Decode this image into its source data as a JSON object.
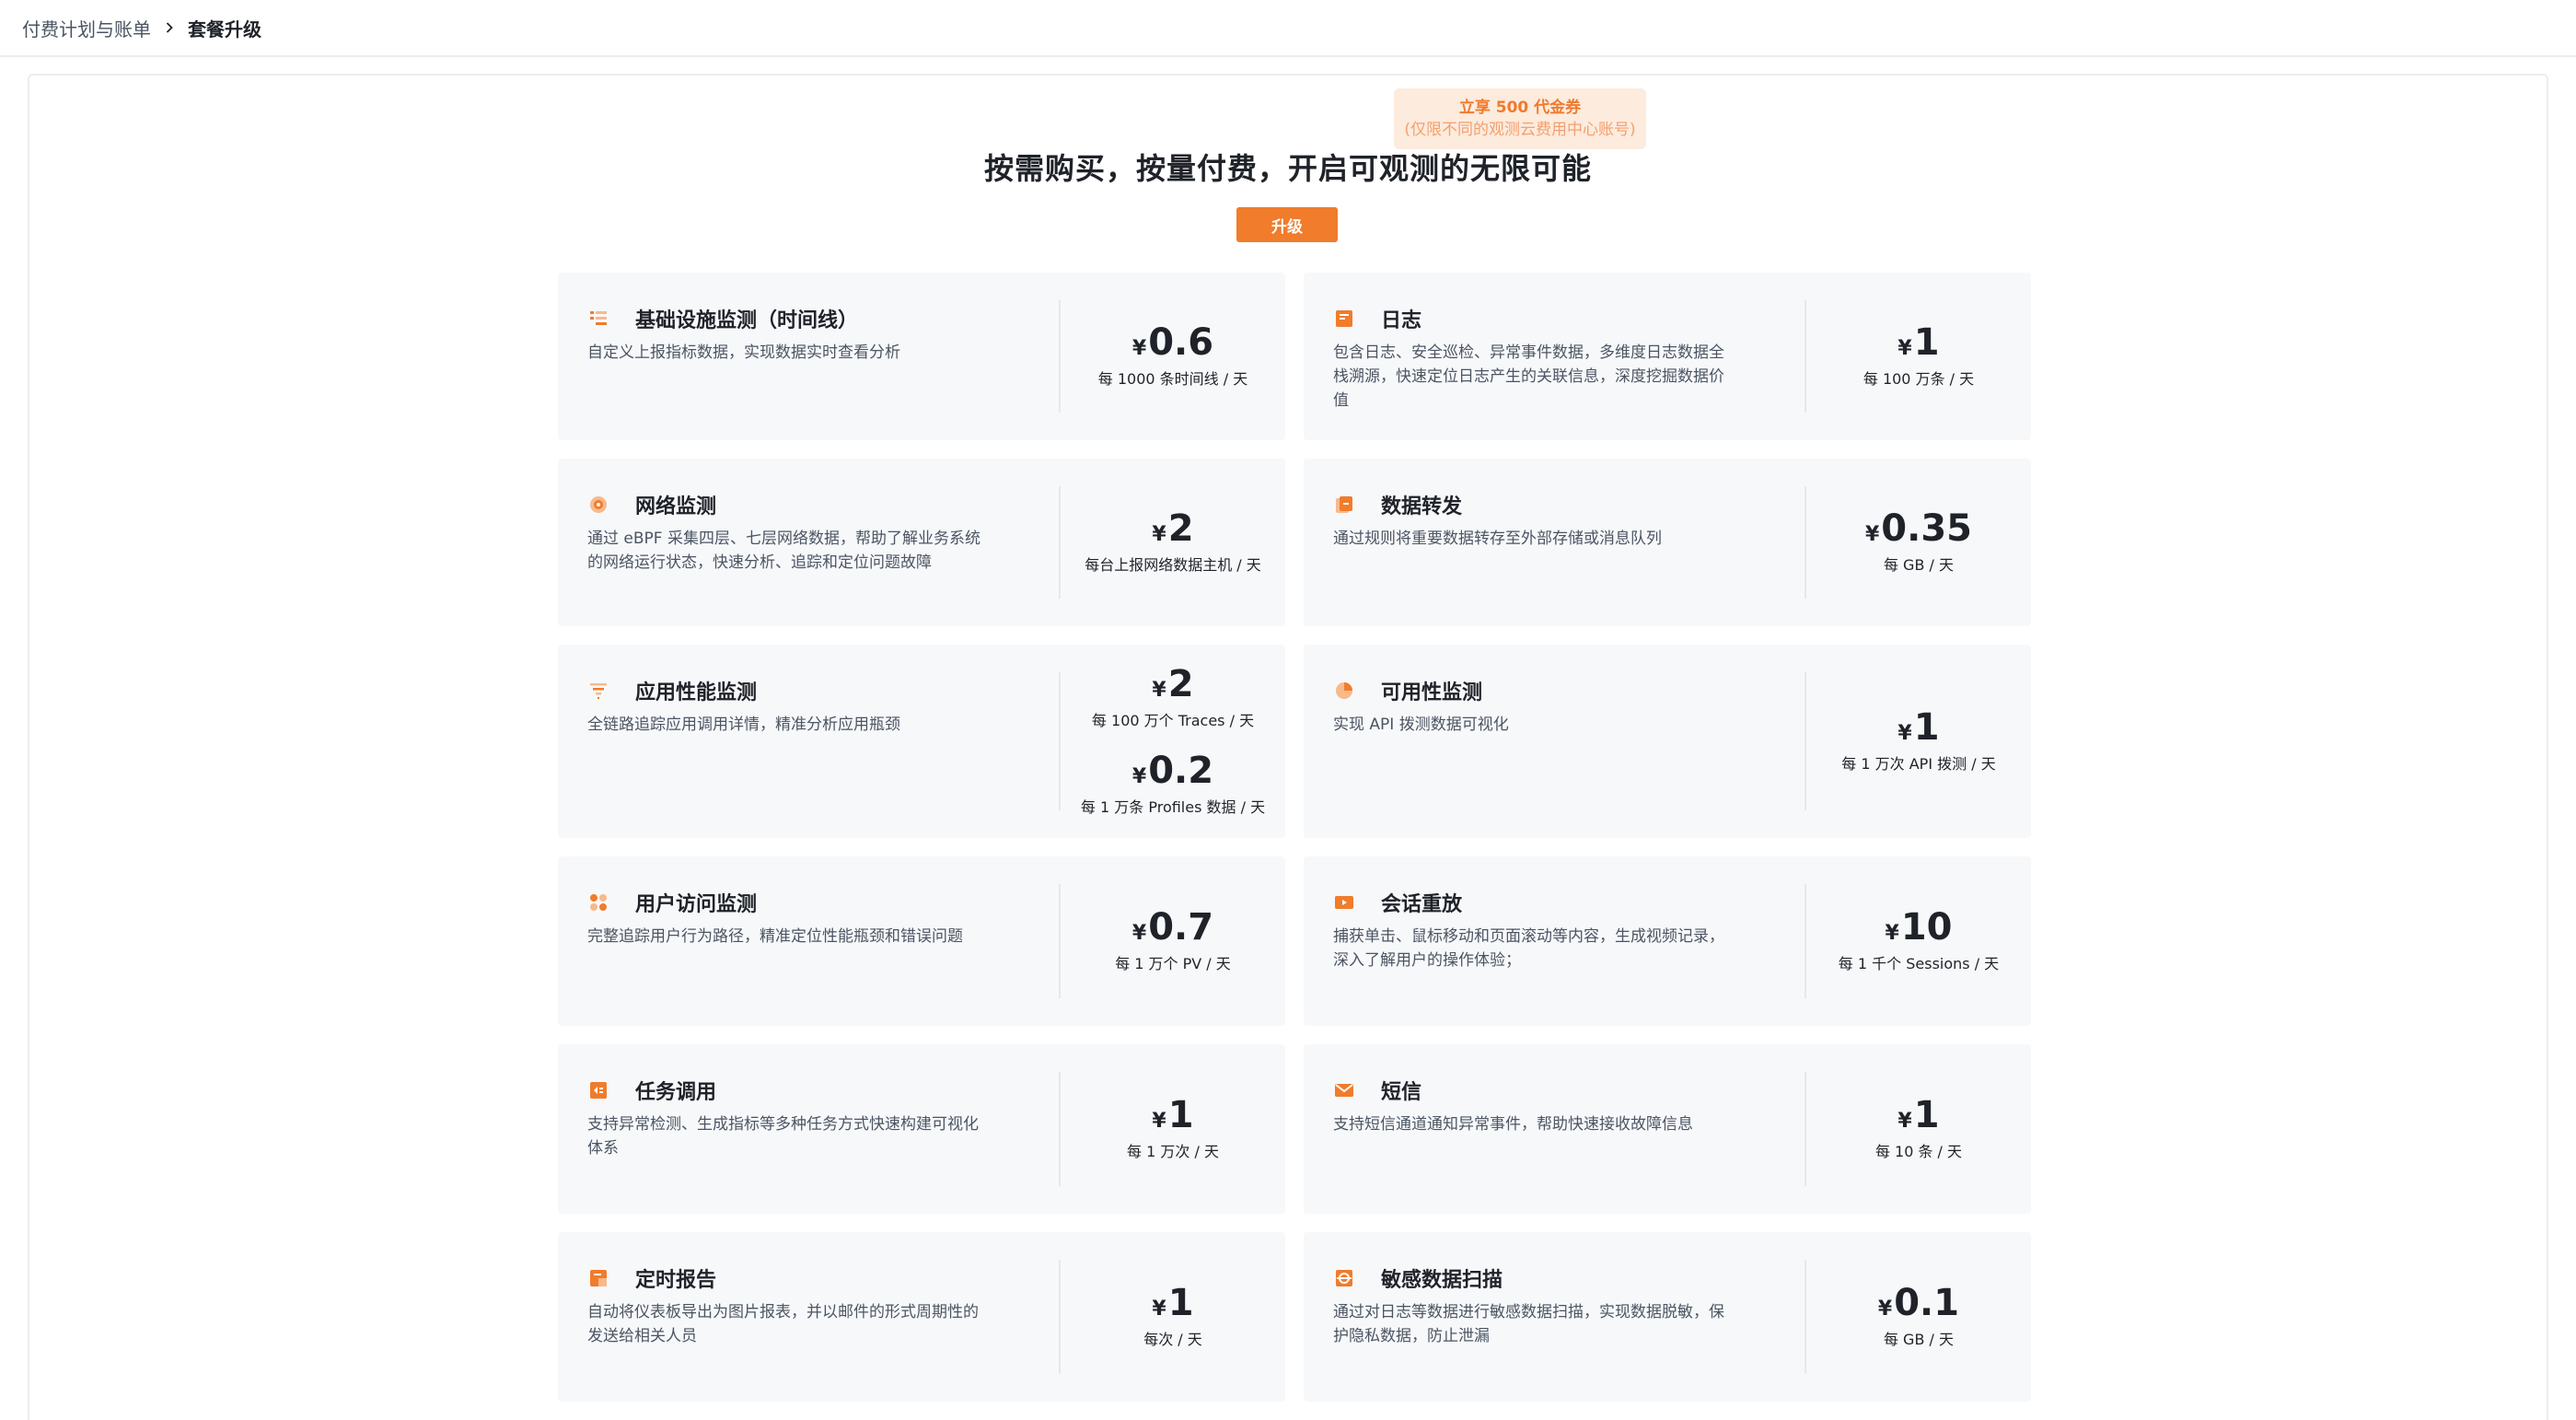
{
  "breadcrumb": {
    "parent": "付费计划与账单",
    "current": "套餐升级"
  },
  "promo": {
    "main": "立享 500 代金券",
    "sub": "(仅限不同的观测云费用中心账号)"
  },
  "headline": "按需购买，按量付费，开启可观测的无限可能",
  "upgrade_button": "升级",
  "accent_color": "#f07c2c",
  "currency": "¥",
  "cards": [
    {
      "title": "基础设施监测（时间线）",
      "icon": "infrastructure-icon",
      "desc": "自定义上报指标数据，实现数据实时查看分析",
      "prices": [
        {
          "value": "0.6",
          "unit": "每 1000 条时间线 / 天"
        }
      ]
    },
    {
      "title": "日志",
      "icon": "log-icon",
      "desc": "包含日志、安全巡检、异常事件数据，多维度日志数据全栈溯源，快速定位日志产生的关联信息，深度挖掘数据价值",
      "prices": [
        {
          "value": "1",
          "unit": "每 100 万条 / 天"
        }
      ]
    },
    {
      "title": "网络监测",
      "icon": "network-icon",
      "desc": "通过 eBPF 采集四层、七层网络数据，帮助了解业务系统的网络运行状态，快速分析、追踪和定位问题故障",
      "prices": [
        {
          "value": "2",
          "unit": "每台上报网络数据主机 / 天"
        }
      ]
    },
    {
      "title": "数据转发",
      "icon": "data-forward-icon",
      "desc": "通过规则将重要数据转存至外部存储或消息队列",
      "prices": [
        {
          "value": "0.35",
          "unit": "每 GB / 天"
        }
      ]
    },
    {
      "title": "应用性能监测",
      "icon": "apm-icon",
      "desc": "全链路追踪应用调用详情，精准分析应用瓶颈",
      "prices": [
        {
          "value": "2",
          "unit": "每 100 万个 Traces / 天"
        },
        {
          "value": "0.2",
          "unit": "每 1 万条 Profiles 数据 / 天"
        }
      ]
    },
    {
      "title": "可用性监测",
      "icon": "availability-icon",
      "desc": "实现 API 拨测数据可视化",
      "prices": [
        {
          "value": "1",
          "unit": "每 1 万次 API 拨测 / 天"
        }
      ]
    },
    {
      "title": "用户访问监测",
      "icon": "rum-icon",
      "desc": "完整追踪用户行为路径，精准定位性能瓶颈和错误问题",
      "prices": [
        {
          "value": "0.7",
          "unit": "每 1 万个 PV / 天"
        }
      ]
    },
    {
      "title": "会话重放",
      "icon": "session-replay-icon",
      "desc": "捕获单击、鼠标移动和页面滚动等内容，生成视频记录，深入了解用户的操作体验；",
      "prices": [
        {
          "value": "10",
          "unit": "每 1 千个 Sessions / 天"
        }
      ]
    },
    {
      "title": "任务调用",
      "icon": "task-call-icon",
      "desc": "支持异常检测、生成指标等多种任务方式快速构建可视化体系",
      "prices": [
        {
          "value": "1",
          "unit": "每 1 万次 / 天"
        }
      ]
    },
    {
      "title": "短信",
      "icon": "sms-icon",
      "desc": "支持短信通道通知异常事件，帮助快速接收故障信息",
      "prices": [
        {
          "value": "1",
          "unit": "每 10 条 / 天"
        }
      ]
    },
    {
      "title": "定时报告",
      "icon": "scheduled-report-icon",
      "desc": "自动将仪表板导出为图片报表，并以邮件的形式周期性的发送给相关人员",
      "prices": [
        {
          "value": "1",
          "unit": "每次 / 天"
        }
      ]
    },
    {
      "title": "敏感数据扫描",
      "icon": "sensitive-scan-icon",
      "desc": "通过对日志等数据进行敏感数据扫描，实现数据脱敏，保护隐私数据，防止泄漏",
      "prices": [
        {
          "value": "0.1",
          "unit": "每 GB / 天"
        }
      ]
    }
  ]
}
